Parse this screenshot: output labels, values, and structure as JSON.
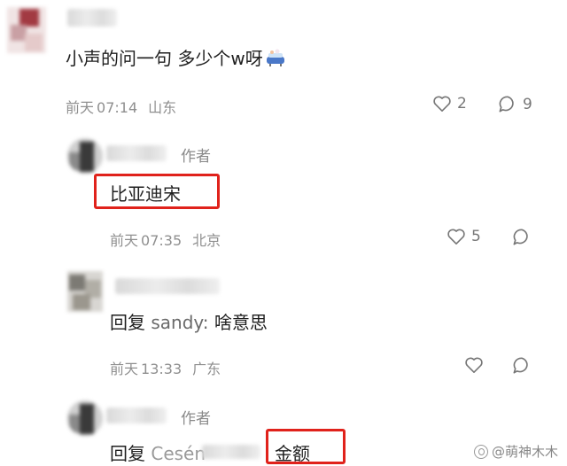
{
  "comments": [
    {
      "text": "小声的问一句 多少个w呀",
      "emoji": "bathtub-emoji",
      "date": "前天",
      "time": "07:14",
      "location": "山东",
      "likes": "2",
      "replies": "9"
    },
    {
      "author_tag": "作者",
      "text": "比亚迪宋",
      "date": "前天",
      "time": "07:35",
      "location": "北京",
      "likes": "5"
    },
    {
      "reply_prefix": "回复",
      "reply_to": "sandy:",
      "text": "啥意思",
      "date": "前天",
      "time": "13:33",
      "location": "广东"
    },
    {
      "author_tag": "作者",
      "reply_prefix": "回复",
      "reply_to": "Cesén",
      "text": "金额"
    }
  ],
  "watermark": "@萌神木木",
  "colors": {
    "highlight": "#e0221b",
    "meta": "#8f8f8f"
  }
}
